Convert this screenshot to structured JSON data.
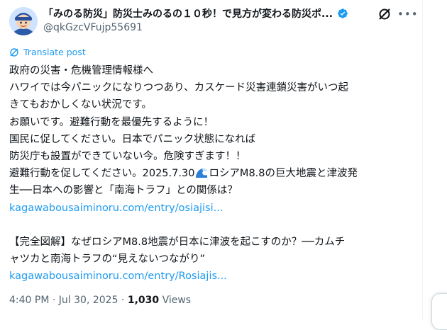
{
  "author": {
    "name": "「みのる防災」防災士みのるの１０秒！で見方が変わる防災ポ...",
    "handle": "@qkGzcVFujp55691"
  },
  "translate_label": "Translate post",
  "body_lines": [
    "政府の災害・危機管理情報様へ",
    "ハワイでは今パニックになりつつあり、カスケード災害連鎖災害がいつ起",
    "きてもおかしくない状況です。",
    "お願いです。避難行動を最優先するように！",
    "国民に促してください。日本でパニック状態になれば",
    "防災庁も設置ができていない今。危険すぎます！！"
  ],
  "line7_prefix": "避難行動を促してください。2025.7.30",
  "line7_suffix": "ロシアM8.8の巨大地震と津波発",
  "line8": "生──日本への影響と「南海トラフ」との関係は？",
  "link1": "kagawabousaiminoru.com/entry/osiajisi...",
  "line10": "【完全図解】なぜロシアM8.8地震が日本に津波を起こすのか？──カムチ",
  "line11": "ャツカと南海トラフの“見えないつながり”",
  "link2": "kagawabousaiminoru.com/entry/Rosiajis...",
  "meta": {
    "time": "4:40 PM",
    "sep1": " · ",
    "date": "Jul 30, 2025",
    "sep2": " · ",
    "views_count": "1,030",
    "views_label": " Views"
  },
  "icons": {
    "verified": "verified-badge-icon",
    "grok": "grok-icon",
    "more": "more-icon",
    "translate": "translate-icon",
    "wave": "water-wave-emoji"
  },
  "colors": {
    "accent": "#1d9bf0",
    "secondary_text": "#536471",
    "primary_text": "#0f1419"
  }
}
